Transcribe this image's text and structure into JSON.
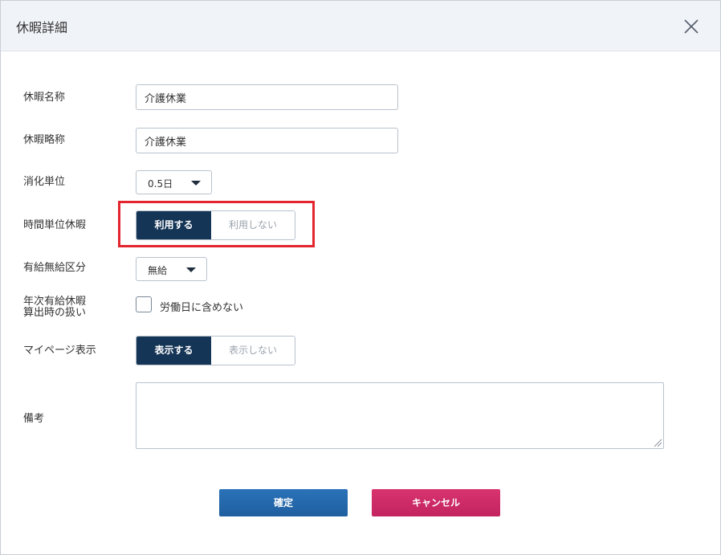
{
  "dialog": {
    "title": "休暇詳細"
  },
  "form": {
    "leave_name": {
      "label": "休暇名称",
      "value": "介護休業"
    },
    "leave_abbr": {
      "label": "休暇略称",
      "value": "介護休業"
    },
    "consumption_unit": {
      "label": "消化単位",
      "selected": "0.5日"
    },
    "hourly_leave": {
      "label": "時間単位休暇",
      "on_label": "利用する",
      "off_label": "利用しない",
      "selected": "利用する"
    },
    "paid_type": {
      "label": "有給無給区分",
      "selected": "無給"
    },
    "annual_calc": {
      "label_line1": "年次有給休暇",
      "label_line2": "算出時の扱い",
      "checkbox_label": "労働日に含めない",
      "checked": false
    },
    "mypage_display": {
      "label": "マイページ表示",
      "on_label": "表示する",
      "off_label": "表示しない",
      "selected": "表示する"
    },
    "remarks": {
      "label": "備考",
      "value": ""
    }
  },
  "buttons": {
    "confirm": "確定",
    "cancel": "キャンセル"
  },
  "colors": {
    "header_bg": "#f0f3f7",
    "toggle_active": "#143556",
    "highlight_border": "#e3262d",
    "confirm_button": "#2a72b8",
    "cancel_button": "#d8336f"
  },
  "icons": {
    "close": "close-icon",
    "dropdown": "chevron-down-icon"
  }
}
